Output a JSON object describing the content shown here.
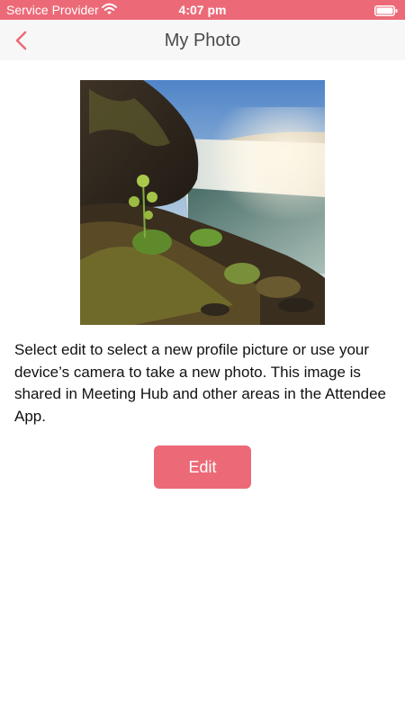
{
  "status_bar": {
    "carrier": "Service Provider",
    "time": "4:07 pm",
    "wifi_icon": "wifi-icon",
    "battery_icon": "battery-icon"
  },
  "nav": {
    "title": "My Photo",
    "back_icon": "chevron-left-icon"
  },
  "profile_photo": {
    "subject": "waterfall landscape photo"
  },
  "description": "Select edit to select a new profile picture or use your device’s camera to take a new photo. This image is shared in Meeting Hub and other areas in the Attendee App.",
  "edit_button": {
    "label": "Edit"
  },
  "colors": {
    "accent": "#ec6a78",
    "nav_background": "#f7f7f7",
    "title_text": "#4a4a4a",
    "body_text": "#111111"
  }
}
